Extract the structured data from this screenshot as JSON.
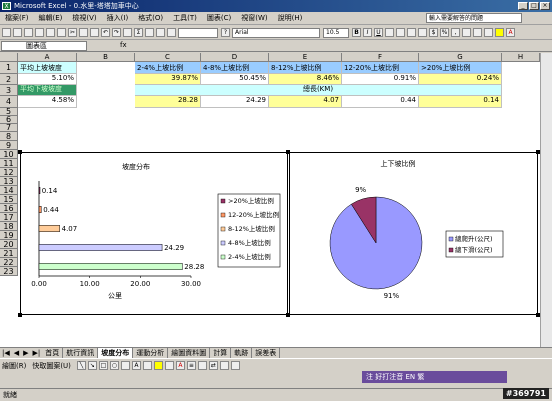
{
  "title": "Microsoft Excel - 0.水里-塔塔加車中心",
  "menu": [
    "檔案(F)",
    "編輯(E)",
    "檢視(V)",
    "插入(I)",
    "格式(O)",
    "工具(T)",
    "圖表(C)",
    "視窗(W)",
    "說明(H)"
  ],
  "help_placeholder": "輸入需要解答的問題",
  "font_name": "Arial",
  "font_size": "10.5",
  "name_box": "圖表區",
  "columns": [
    "A",
    "B",
    "C",
    "D",
    "E",
    "F",
    "G",
    "H"
  ],
  "rows": [
    "1",
    "2",
    "3",
    "4",
    "5",
    "6",
    "7",
    "8",
    "9",
    "10",
    "11",
    "12",
    "13",
    "14",
    "15",
    "16",
    "17",
    "18",
    "19",
    "20",
    "21",
    "22",
    "23"
  ],
  "cells": {
    "a1": "平均上坡坡度",
    "a2": "5.10%",
    "a3": "平均下坡坡度",
    "a4": "4.58%",
    "c1": "2-4%上坡比例",
    "d1": "4-8%上坡比例",
    "e1": "8-12%上坡比例",
    "f1": "12-20%上坡比例",
    "g1": ">20%上坡比例",
    "c2": "39.87%",
    "d2": "50.45%",
    "e2": "8.46%",
    "f2": "0.91%",
    "g2": "0.24%",
    "e3": "總長(KM)",
    "c4": "28.28",
    "d4": "24.29",
    "e4": "4.07",
    "f4": "0.44",
    "g4": "0.14"
  },
  "chart_data": [
    {
      "type": "bar",
      "title": "坡度分布",
      "categories": [
        ">20%上坡比例",
        "12-20%上坡比例",
        "8-12%上坡比例",
        "4-8%上坡比例",
        "2-4%上坡比例"
      ],
      "values": [
        0.14,
        0.44,
        4.07,
        24.29,
        28.28
      ],
      "data_labels": [
        "0.14",
        "0.44",
        "4.07",
        "24.29",
        "28.28"
      ],
      "xlabel": "公里",
      "x_ticks": [
        "0.00",
        "10.00",
        "20.00",
        "30.00"
      ],
      "xlim": [
        0,
        30
      ],
      "colors": [
        "#993366",
        "#ff9966",
        "#ffcc99",
        "#ccccff",
        "#ccffcc"
      ],
      "legend_position": "right"
    },
    {
      "type": "pie",
      "title": "上下坡比例",
      "labels": [
        "總爬升(公尺)",
        "總下滑(公尺)"
      ],
      "values": [
        91,
        9
      ],
      "data_labels": [
        "91%",
        "9%"
      ],
      "colors": [
        "#9999ff",
        "#993366"
      ],
      "legend_position": "right"
    }
  ],
  "sheet_tabs": [
    "首頁",
    "航行資訊",
    "坡度分布",
    "運動分析",
    "繪圖資料圖",
    "計算",
    "軌跡",
    "誤差表"
  ],
  "active_tab": "坡度分布",
  "draw_label": "繪圖(R)",
  "autoshape_label": "快取圖案(U)",
  "status": "就緒",
  "ime": "注 好打注音  EN  繁",
  "watermark": "#369791"
}
